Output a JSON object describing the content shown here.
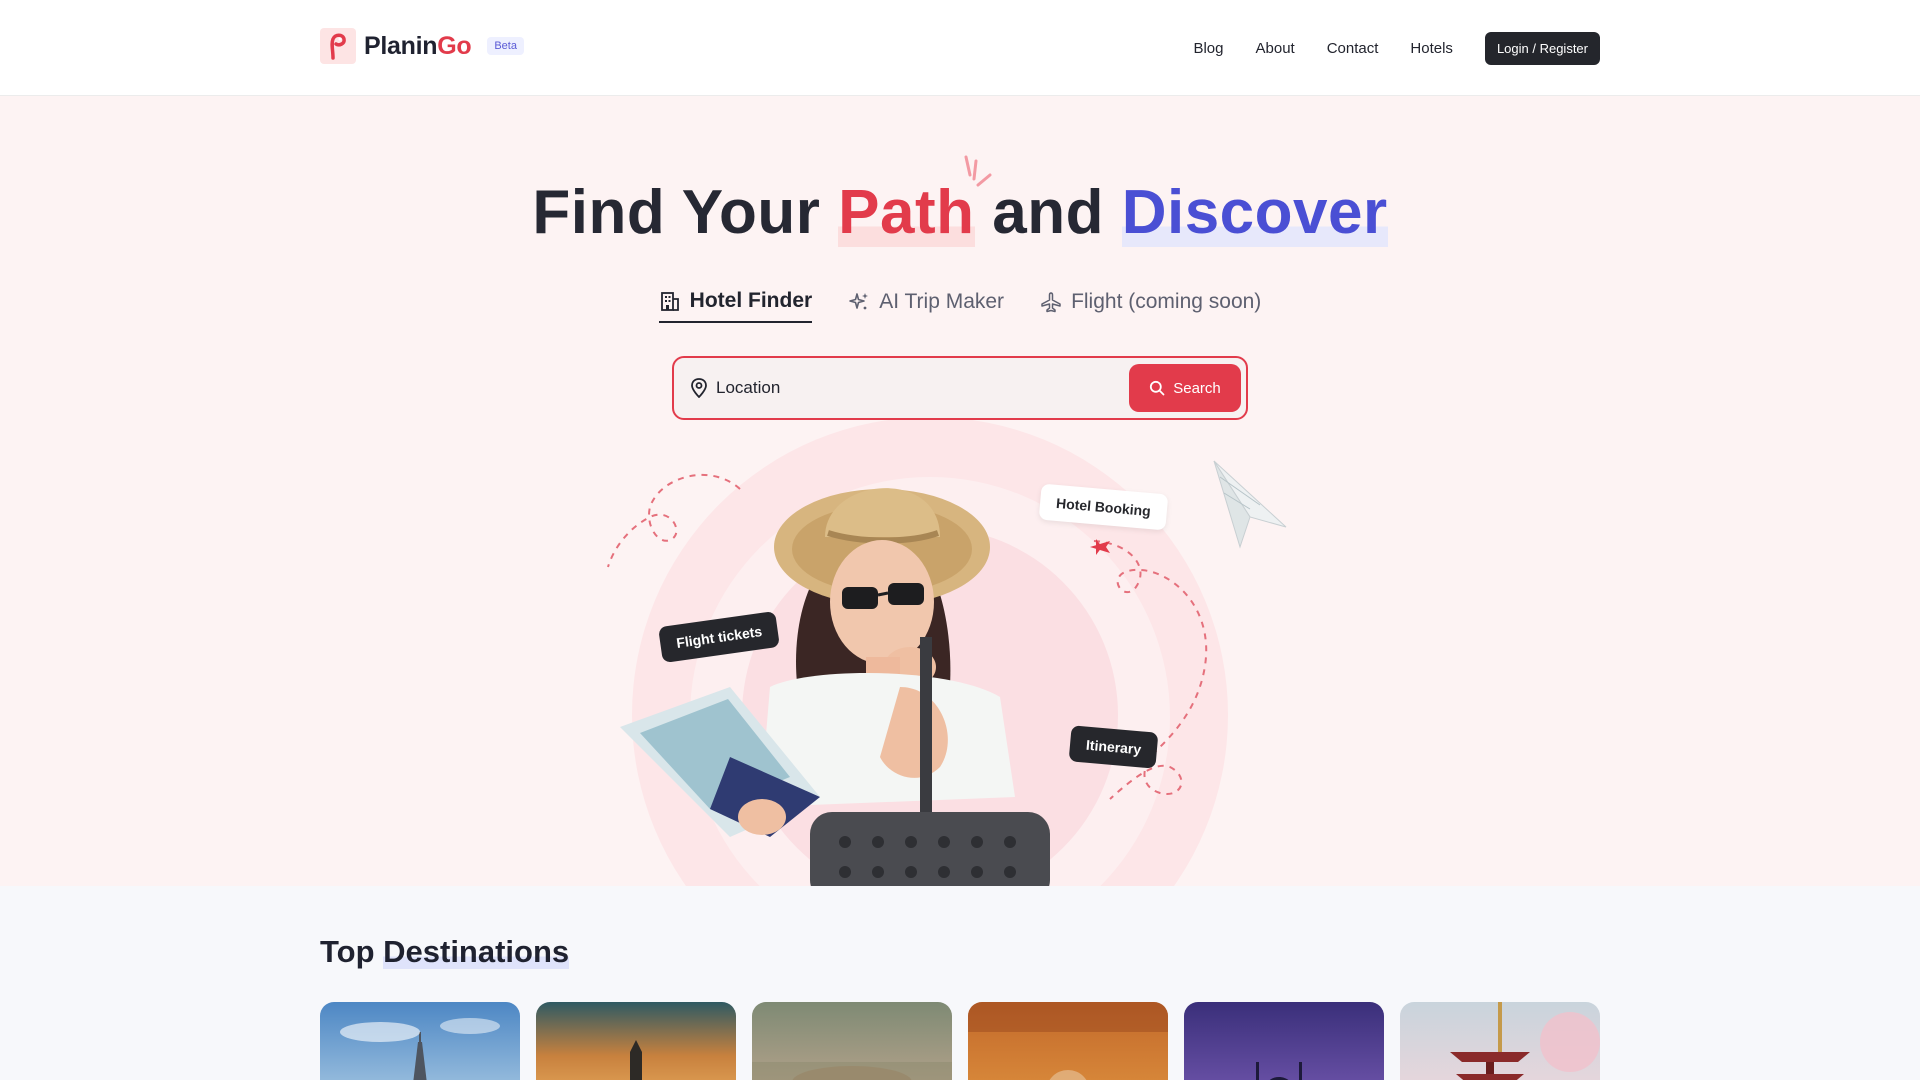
{
  "header": {
    "brand_main": "Planin",
    "brand_accent": "Go",
    "badge": "Beta",
    "nav": [
      "Blog",
      "About",
      "Contact",
      "Hotels"
    ],
    "login_label": "Login / Register"
  },
  "hero": {
    "headline": {
      "part1": "Find Your ",
      "path": "Path",
      "part2": " and ",
      "discover": "Discover"
    },
    "tabs": [
      {
        "label": "Hotel Finder",
        "icon": "building-icon",
        "active": true
      },
      {
        "label": "AI Trip Maker",
        "icon": "sparkle-icon",
        "active": false
      },
      {
        "label": "Flight (coming soon)",
        "icon": "plane-icon",
        "active": false
      }
    ],
    "search": {
      "placeholder": "Location",
      "button_label": "Search"
    },
    "tags": {
      "hotel": "Hotel Booking",
      "flight": "Flight tickets",
      "itinerary": "Itinerary"
    }
  },
  "destinations": {
    "title_part1": "Top ",
    "title_part2": "Destinations"
  },
  "colors": {
    "accent_red": "#e23b4b",
    "accent_blue": "#4a4fd4",
    "dark": "#24262c"
  }
}
